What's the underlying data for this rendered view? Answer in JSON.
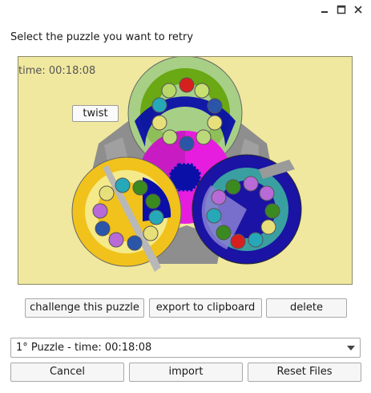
{
  "window": {
    "controls": [
      "minimize-icon",
      "maximize-icon",
      "close-icon"
    ]
  },
  "prompt": "Select the puzzle you want to retry",
  "preview": {
    "timer_label": "time: 00:18:08",
    "twist_label": "twist",
    "colors": {
      "background": "#f0e89f",
      "top_ring_green": "#a7cf86",
      "left_ring_yellow": "#f1c21b",
      "right_ring_blue": "#1a13a3",
      "center_magenta": "#e61ddf",
      "center_blue": "#0a0fa8",
      "grey": "#8e8e8e"
    }
  },
  "actions": {
    "challenge": "challenge this puzzle",
    "export": "export to clipboard",
    "delete": "delete"
  },
  "puzzle_select": {
    "selected": "1° Puzzle - time: 00:18:08"
  },
  "footer": {
    "cancel": "Cancel",
    "import": "import",
    "reset": "Reset Files"
  }
}
